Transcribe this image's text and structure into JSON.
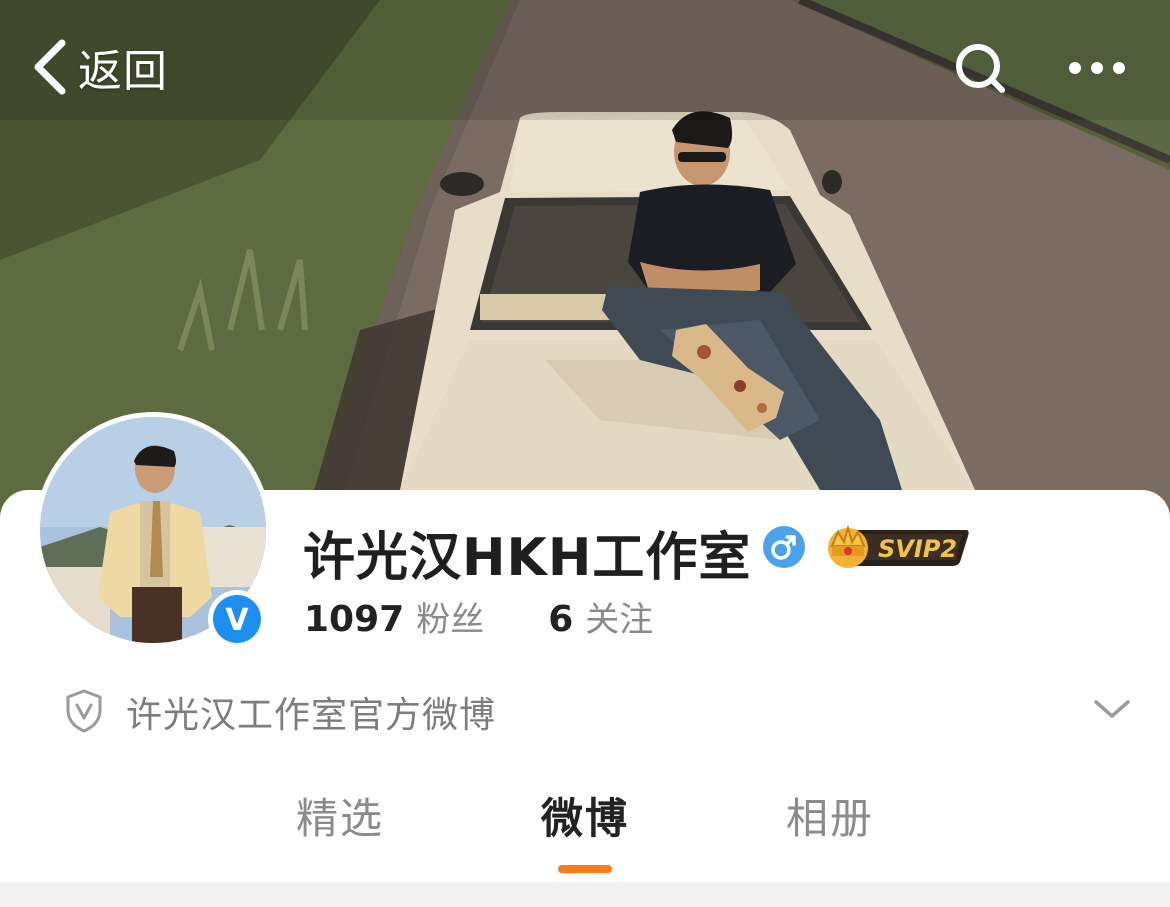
{
  "nav": {
    "back_label": "返回",
    "icons": {
      "back": "chevron-left-icon",
      "search": "search-icon",
      "more": "more-dots-icon"
    }
  },
  "profile": {
    "name": "许光汉HKH工作室",
    "gender": "male",
    "gender_icon": "male-icon",
    "vip_badge": "SVIP2",
    "verified": true,
    "verified_symbol": "V",
    "followers_count": "1097",
    "followers_label": "粉丝",
    "following_count": "6",
    "following_label": "关注",
    "description": "许光汉工作室官方微博"
  },
  "tabs": [
    {
      "label": "精选",
      "active": false
    },
    {
      "label": "微博",
      "active": true
    },
    {
      "label": "相册",
      "active": false
    }
  ],
  "colors": {
    "accent": "#ff7a1a",
    "verified_blue": "#1e8ef0",
    "gender_blue": "#4aa3ea",
    "vip_gold": "#f2b233",
    "text_primary": "#1f1f1f",
    "text_secondary": "#8a8a8a"
  }
}
